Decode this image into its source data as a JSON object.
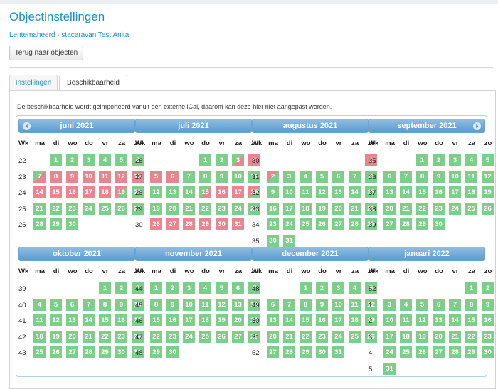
{
  "page": {
    "title": "Objectinstellingen",
    "subtitle": "Lentemaheerd - stacaravan Test Anita",
    "back_button": "Terug naar objecten"
  },
  "tabs": [
    {
      "label": "Instellingen",
      "active": false
    },
    {
      "label": "Beschikbaarheid",
      "active": true
    }
  ],
  "info_text": "De beschikbaarheid wordt geimporteerd vanuit een externe iCal, daarom kan deze hier niet aangepast worden.",
  "weekday_headers": [
    "Wk",
    "ma",
    "di",
    "wo",
    "do",
    "vr",
    "za",
    "zo"
  ],
  "legend_colors": {
    "free": "#7ccf8a",
    "booked": "#e8858f",
    "header": "#5c9bd1"
  },
  "months": [
    {
      "name": "juni 2021",
      "year": 2021,
      "month": 6,
      "booked": [
        8,
        9,
        10,
        11,
        12,
        13,
        14,
        15,
        16,
        17,
        18
      ],
      "arrival": [
        7
      ],
      "departure": [
        19
      ]
    },
    {
      "name": "juli 2021",
      "year": 2021,
      "month": 7,
      "booked": [
        4,
        5,
        6,
        16,
        17,
        26,
        27,
        28,
        29,
        30,
        31
      ],
      "arrival": [
        3,
        15
      ],
      "departure": [
        18,
        26
      ]
    },
    {
      "name": "augustus 2021",
      "year": 2021,
      "month": 8,
      "booked": [
        1
      ],
      "arrival": [],
      "departure": [
        2
      ]
    },
    {
      "name": "september 2021",
      "year": 2021,
      "month": 9,
      "booked": [],
      "arrival": [],
      "departure": []
    },
    {
      "name": "oktober 2021",
      "year": 2021,
      "month": 10,
      "booked": [],
      "arrival": [],
      "departure": []
    },
    {
      "name": "november 2021",
      "year": 2021,
      "month": 11,
      "booked": [],
      "arrival": [],
      "departure": []
    },
    {
      "name": "december 2021",
      "year": 2021,
      "month": 12,
      "booked": [],
      "arrival": [],
      "departure": []
    },
    {
      "name": "januari 2022",
      "year": 2022,
      "month": 1,
      "booked": [],
      "arrival": [],
      "departure": []
    }
  ]
}
